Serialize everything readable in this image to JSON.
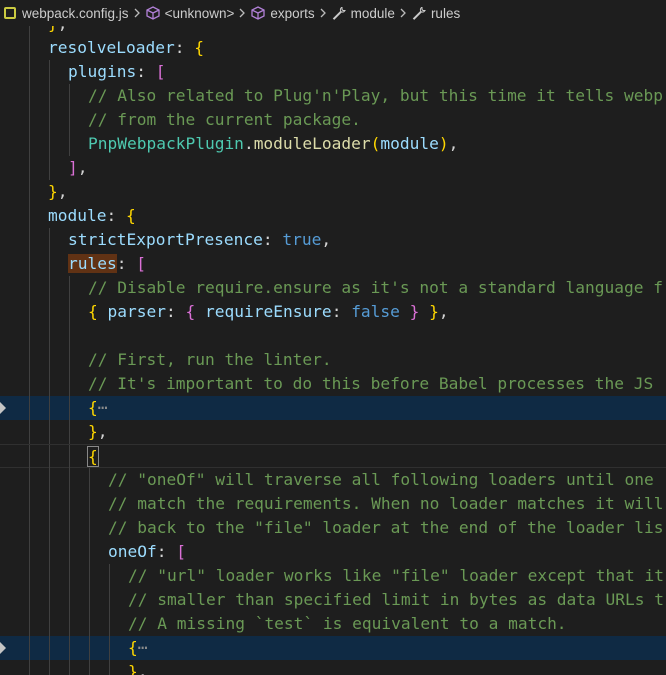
{
  "breadcrumb": {
    "file": "webpack.config.js",
    "items": [
      "<unknown>",
      "exports",
      "module",
      "rules"
    ]
  },
  "code": {
    "resolveLoader_key": "resolveLoader",
    "plugins_key": "plugins",
    "comment_pnp_1": "// Also related to Plug'n'Play, but this time it tells webp",
    "comment_pnp_2": "// from the current package.",
    "pnp_class": "PnpWebpackPlugin",
    "pnp_method": "moduleLoader",
    "pnp_arg": "module",
    "module_key": "module",
    "strict_key": "strictExportPresence",
    "strict_val": "true",
    "rules_key": "rules",
    "comment_disable": "// Disable require.ensure as it's not a standard language f",
    "parser_key": "parser",
    "require_key": "requireEnsure",
    "require_val": "false",
    "comment_first": "// First, run the linter.",
    "comment_important": "// It's important to do this before Babel processes the JS",
    "ellipsis": "⋯",
    "comment_oneof_1": "// \"oneOf\" will traverse all following loaders until one",
    "comment_oneof_2": "// match the requirements. When no loader matches it will",
    "comment_oneof_3": "// back to the \"file\" loader at the end of the loader lis",
    "oneof_key": "oneOf",
    "comment_url_1": "// \"url\" loader works like \"file\" loader except that it",
    "comment_url_2": "// smaller than specified limit in bytes as data URLs t",
    "comment_url_3": "// A missing `test` is equivalent to a match."
  }
}
